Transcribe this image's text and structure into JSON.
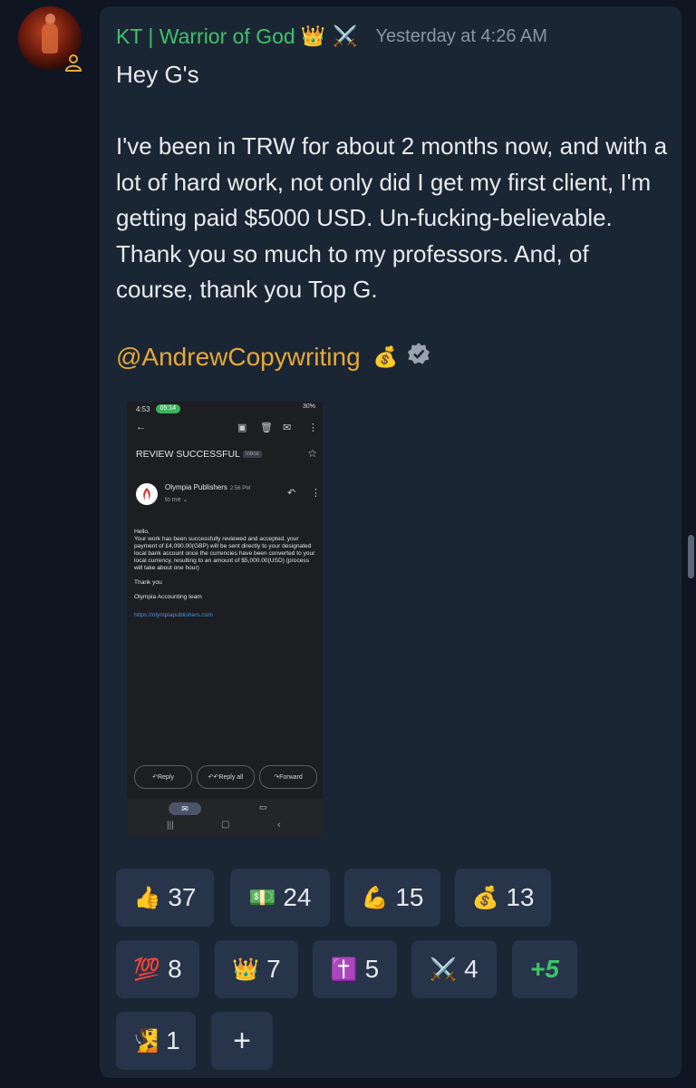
{
  "message": {
    "author": "KT | Warrior of God",
    "author_emojis": [
      "👑",
      "⚔️"
    ],
    "timestamp": "Yesterday at 4:26 AM",
    "body": "Hey G's\n\nI've been in TRW for about 2 months now, and with a lot of hard work, not only did I get my first client, I'm getting paid $5000 USD. Un-fucking-believable. Thank you so much to my professors. And, of course, thank you Top G.",
    "mention": "@AndrewCopywriting",
    "mention_emoji": "💰"
  },
  "attachment": {
    "status_time": "4:53",
    "call_chip": "05:14",
    "status_right": "30%",
    "subject": "REVIEW SUCCESSFUL",
    "label": "Inbox",
    "sender": "Olympia Publishers",
    "sent_time": "2:56 PM",
    "to": "to me",
    "body": "Hello,\nYour work has been successfully reviewed and accepted, your payment of £4,090.00(GBP) will be sent directly to your designated local bank account once the currencies have been converted to your local currency, resulting to an amount of $5,000.00(USD) (process will take about one hour)\n\nThank you\n\nOlympia Accounting team",
    "link": "https://olympiapublishers.com",
    "buttons": [
      "Reply",
      "Reply all",
      "Forward"
    ]
  },
  "reactions": [
    {
      "emoji": "👍",
      "count": "37"
    },
    {
      "emoji": "💵",
      "count": "24"
    },
    {
      "emoji": "💪",
      "count": "15"
    },
    {
      "emoji": "💰",
      "count": "13"
    },
    {
      "emoji": "💯",
      "count": "8"
    },
    {
      "emoji": "👑",
      "count": "7"
    },
    {
      "emoji": "✝️",
      "count": "5"
    },
    {
      "emoji": "⚔️",
      "count": "4"
    },
    {
      "emoji": "🧏",
      "count": "1"
    }
  ],
  "more_reactions": "+5",
  "add_reaction": "+"
}
